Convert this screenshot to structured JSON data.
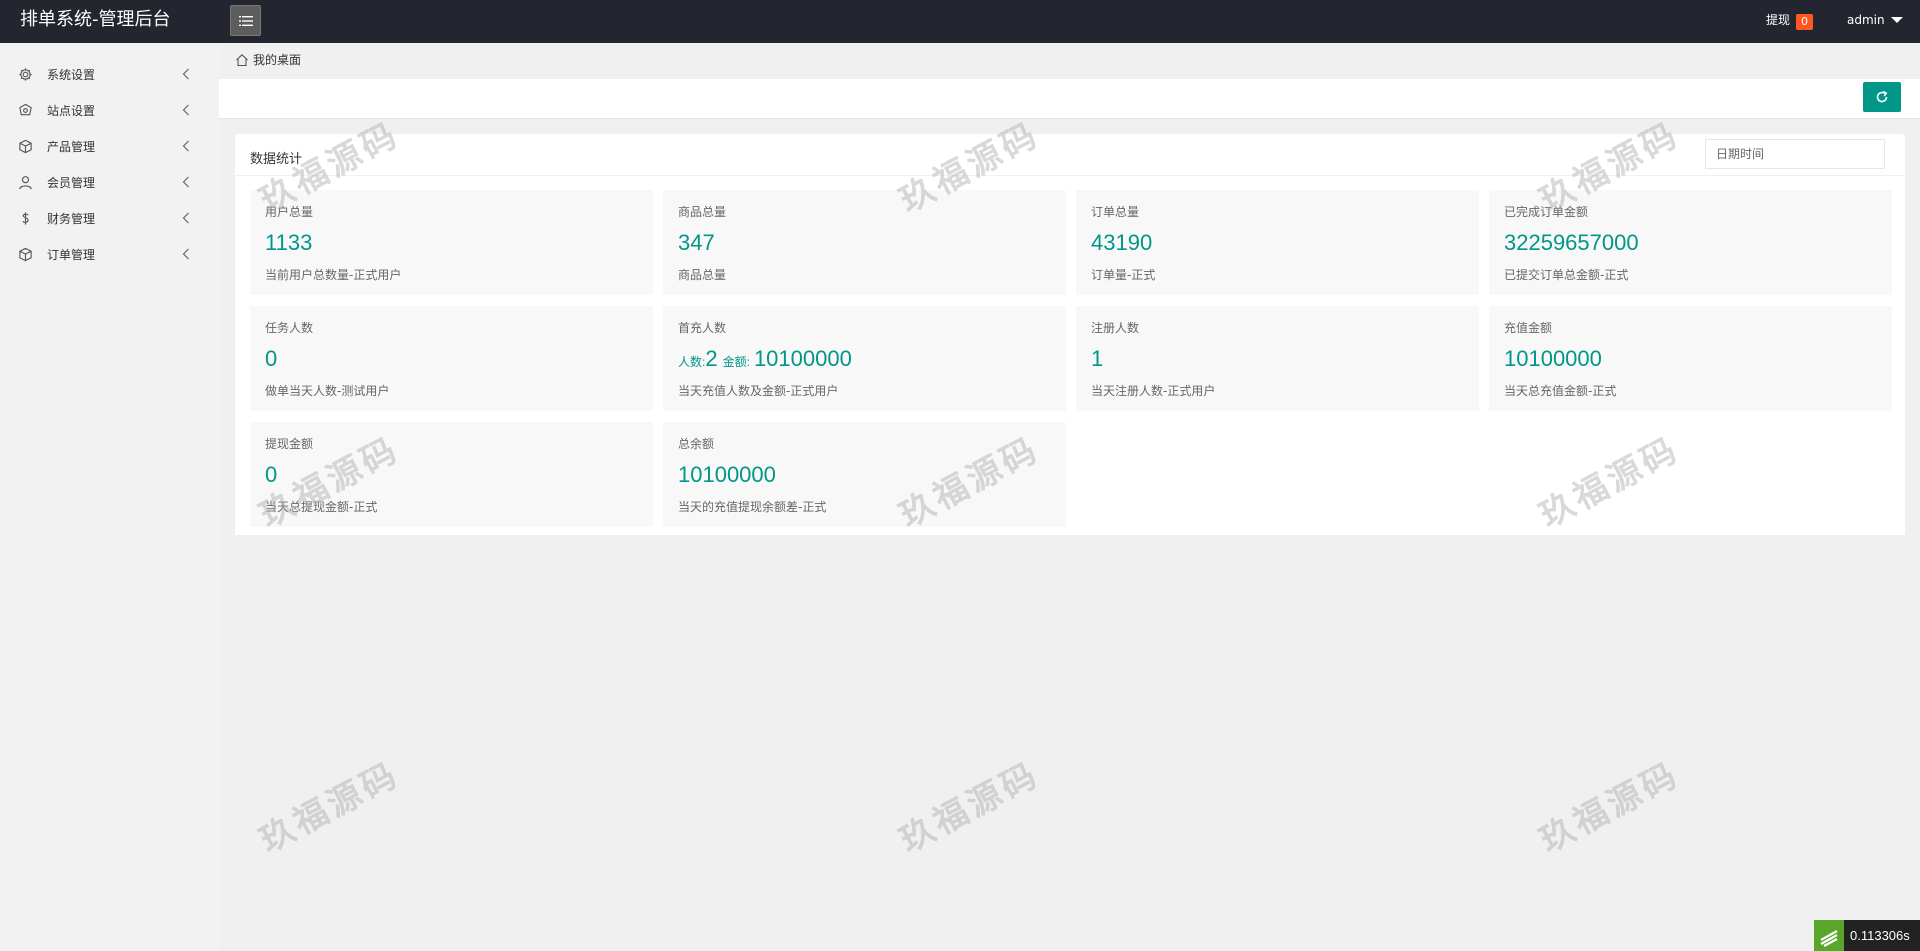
{
  "header": {
    "title": "排单系统-管理后台",
    "withdraw_label": "提现",
    "withdraw_count": "0",
    "user_name": "admin"
  },
  "sidebar": {
    "items": [
      {
        "label": "系统设置",
        "icon": "gear-icon"
      },
      {
        "label": "站点设置",
        "icon": "site-icon"
      },
      {
        "label": "产品管理",
        "icon": "box-icon"
      },
      {
        "label": "会员管理",
        "icon": "user-icon"
      },
      {
        "label": "财务管理",
        "icon": "dollar-icon"
      },
      {
        "label": "订单管理",
        "icon": "box-icon"
      }
    ]
  },
  "breadcrumb": {
    "label": "我的桌面"
  },
  "stats_panel": {
    "title": "数据统计",
    "date_placeholder": "日期时间"
  },
  "stats": {
    "total_users": {
      "title": "用户总量",
      "value": "1133",
      "desc": "当前用户总数量-正式用户"
    },
    "total_products": {
      "title": "商品总量",
      "value": "347",
      "desc": "商品总量"
    },
    "total_orders": {
      "title": "订单总量",
      "value": "43190",
      "desc": "订单量-正式"
    },
    "completed_amount": {
      "title": "已完成订单金额",
      "value": "32259657000",
      "desc": "已提交订单总金额-正式"
    },
    "task_users": {
      "title": "任务人数",
      "value": "0",
      "desc": "做单当天人数-测试用户"
    },
    "first_recharge": {
      "title": "首充人数",
      "count_label": "人数:",
      "count": "2",
      "amount_label": "金额:",
      "amount": "10100000",
      "desc": "当天充值人数及金额-正式用户"
    },
    "registered": {
      "title": "注册人数",
      "value": "1",
      "desc": "当天注册人数-正式用户"
    },
    "recharge_amount": {
      "title": "充值金额",
      "value": "10100000",
      "desc": "当天总充值金额-正式"
    },
    "withdraw_amount": {
      "title": "提现金额",
      "value": "0",
      "desc": "当天总提现金额-正式"
    },
    "total_balance": {
      "title": "总余额",
      "value": "10100000",
      "desc": "当天的充值提现余额差-正式"
    }
  },
  "watermark": "玖福源码",
  "timer": "0.113306s",
  "colors": {
    "accent": "#009688",
    "topbar": "#23262e",
    "badge": "#ff5722"
  }
}
